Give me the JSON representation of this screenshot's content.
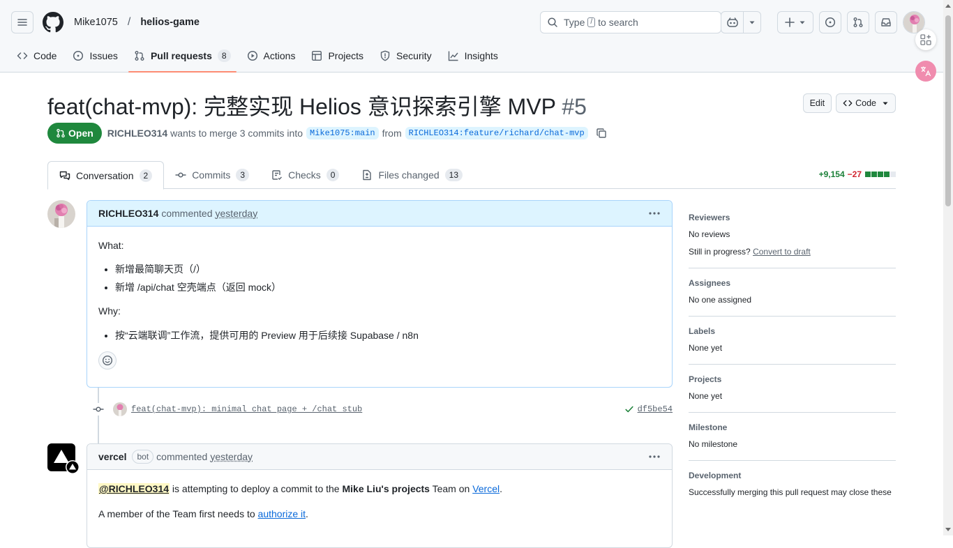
{
  "header": {
    "owner": "Mike1075",
    "separator": "/",
    "repo": "helios-game",
    "search_prefix": "Type",
    "search_key": "/",
    "search_suffix": "to search"
  },
  "repo_tabs": [
    {
      "label": "Code",
      "icon": "code-icon"
    },
    {
      "label": "Issues",
      "icon": "issue-icon"
    },
    {
      "label": "Pull requests",
      "icon": "pull-request-icon",
      "count": "8",
      "active": true
    },
    {
      "label": "Actions",
      "icon": "play-icon"
    },
    {
      "label": "Projects",
      "icon": "table-icon"
    },
    {
      "label": "Security",
      "icon": "shield-icon"
    },
    {
      "label": "Insights",
      "icon": "graph-icon"
    }
  ],
  "pr": {
    "title": "feat(chat-mvp): 完整实现 Helios 意识探索引擎 MVP",
    "number": "#5",
    "edit_label": "Edit",
    "code_label": "Code",
    "state": "Open",
    "author": "RICHLEO314",
    "merge_text": "wants to merge 3 commits into",
    "base_branch": "Mike1075:main",
    "from_text": "from",
    "head_branch": "RICHLEO314:feature/richard/chat-mvp"
  },
  "pr_tabs": [
    {
      "label": "Conversation",
      "count": "2",
      "active": true
    },
    {
      "label": "Commits",
      "count": "3"
    },
    {
      "label": "Checks",
      "count": "0"
    },
    {
      "label": "Files changed",
      "count": "13"
    }
  ],
  "diffstat": {
    "additions": "+9,154",
    "deletions": "−27",
    "green_blocks": 4,
    "gray_blocks": 1
  },
  "comment1": {
    "author": "RICHLEO314",
    "action": "commented",
    "time": "yesterday",
    "what_label": "What:",
    "what_items": [
      "新增最简聊天页（/）",
      "新增 /api/chat 空壳端点（返回 mock）"
    ],
    "why_label": "Why:",
    "why_items": [
      "按“云端联调”工作流，提供可用的 Preview 用于后续接 Supabase / n8n"
    ]
  },
  "commit": {
    "message": "feat(chat-mvp): minimal chat page + /chat stub",
    "sha": "df5be54"
  },
  "comment2": {
    "author": "vercel",
    "badge": "bot",
    "action": "commented",
    "time": "yesterday",
    "mention": "@RICHLEO314",
    "line1_mid": "is attempting to deploy a commit to the",
    "team_name": "Mike Liu's projects",
    "line1_team": "Team on",
    "vercel_link": "Vercel",
    "line2_start": "A member of the Team first needs to",
    "authorize_link": "authorize it"
  },
  "sidebar": {
    "reviewers_title": "Reviewers",
    "reviewers_value": "No reviews",
    "in_progress": "Still in progress?",
    "convert_draft": "Convert to draft",
    "assignees_title": "Assignees",
    "assignees_value": "No one assigned",
    "labels_title": "Labels",
    "labels_value": "None yet",
    "projects_title": "Projects",
    "projects_value": "None yet",
    "milestone_title": "Milestone",
    "milestone_value": "No milestone",
    "development_title": "Development",
    "development_value": "Successfully merging this pull request may close these"
  },
  "colors": {
    "open_green": "#1f883d",
    "accent_blue": "#0969da",
    "tab_underline": "#fd8c73",
    "own_comment_header": "#ddf4ff"
  }
}
